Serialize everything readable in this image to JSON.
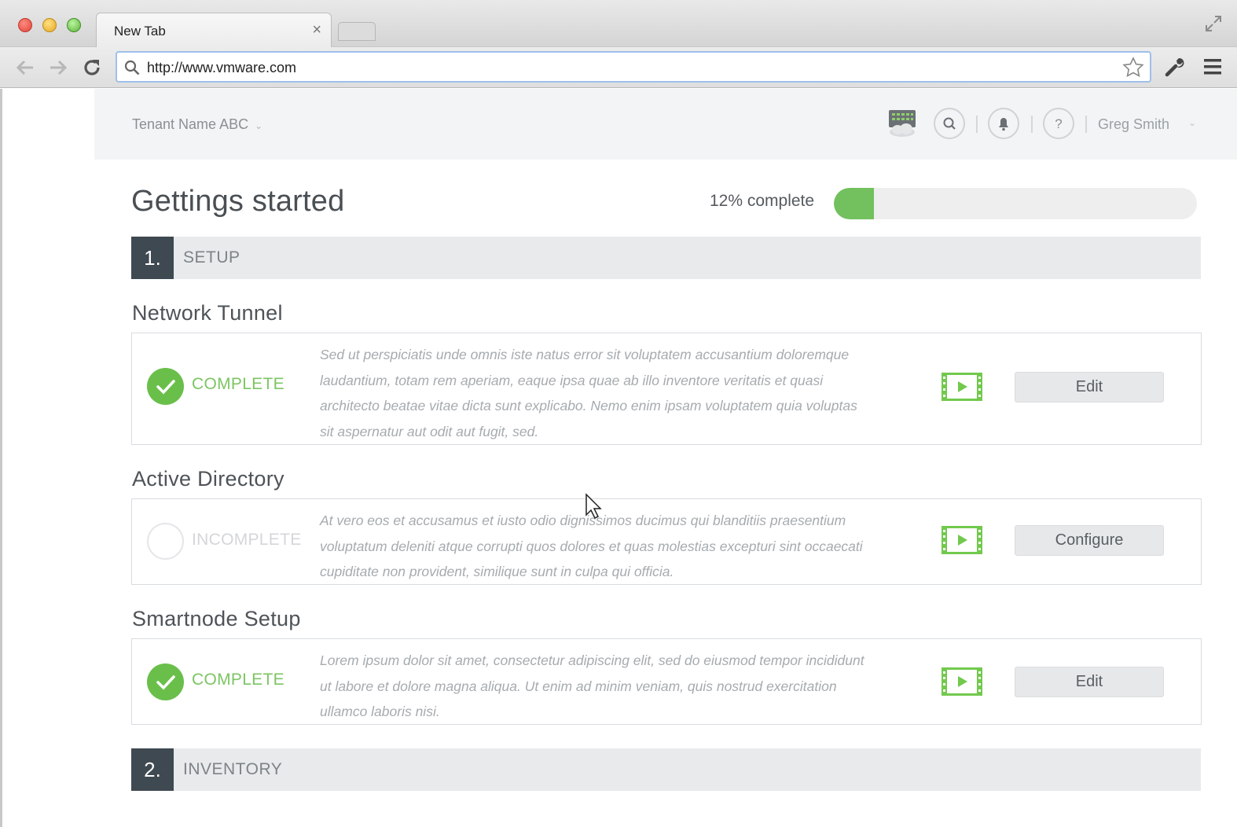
{
  "browser": {
    "tab_title": "New Tab",
    "tab_close": "×",
    "url": "http://www.vmware.com"
  },
  "header": {
    "tenant": "Tenant Name ABC",
    "tenant_chevron": "⌄",
    "user_name": "Greg Smith",
    "user_chevron": "⌄",
    "icons": [
      "apps-cloud-icon",
      "search-icon",
      "bell-icon",
      "help-icon"
    ]
  },
  "main": {
    "title": "Gettings started",
    "progress_text": "12% complete",
    "progress_value": 0.11
  },
  "sections": [
    {
      "number": "1.",
      "label": "SETUP"
    },
    {
      "number": "2.",
      "label": "INVENTORY"
    }
  ],
  "items": [
    {
      "title": "Network Tunnel",
      "status": "COMPLETE",
      "description": "Sed ut perspiciatis unde omnis iste natus error sit voluptatem accusantium doloremque laudantium, totam rem aperiam, eaque ipsa quae ab illo inventore veritatis et quasi architecto beatae vitae dicta sunt explicabo. Nemo enim ipsam voluptatem quia voluptas sit aspernatur aut odit aut fugit, sed.",
      "action": "Edit"
    },
    {
      "title": "Active Directory",
      "status": "INCOMPLETE",
      "description": "At vero eos et accusamus et iusto odio dignissimos ducimus qui blanditiis praesentium voluptatum deleniti atque corrupti quos dolores et quas molestias excepturi sint occaecati cupiditate non provident, similique sunt in culpa qui officia.",
      "action": "Configure"
    },
    {
      "title": "Smartnode Setup",
      "status": "COMPLETE",
      "description": "Lorem ipsum dolor sit amet, consectetur adipiscing elit, sed do eiusmod tempor incididunt ut labore et dolore magna aliqua. Ut enim ad minim veniam, quis nostrud exercitation ullamco laboris nisi.",
      "action": "Edit"
    }
  ],
  "colors": {
    "accent_green": "#6abf4b",
    "section_number_bg": "#3e4951",
    "header_bg": "#f3f4f5"
  }
}
